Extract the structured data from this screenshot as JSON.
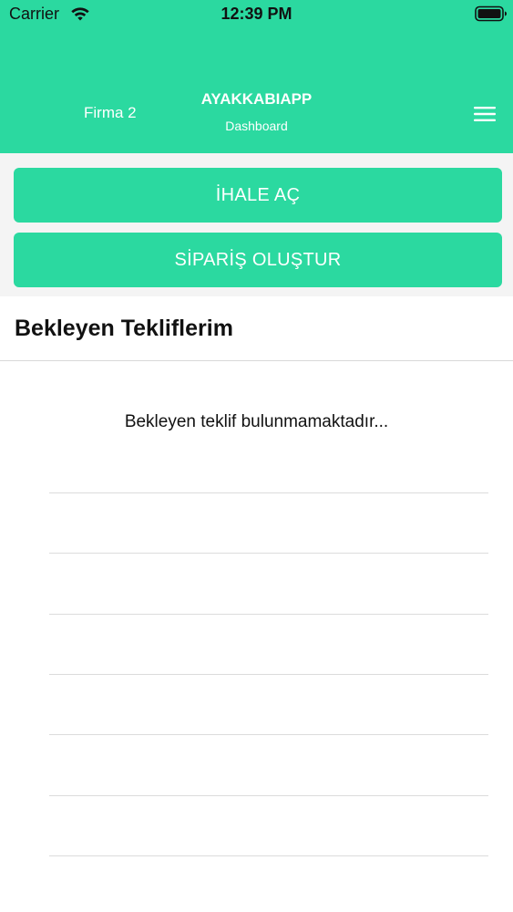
{
  "status_bar": {
    "carrier": "Carrier",
    "time": "12:39 PM"
  },
  "header": {
    "company": "Firma 2",
    "title": "AYAKKABIAPP",
    "subtitle": "Dashboard",
    "background_color": "#2bd9a0"
  },
  "actions": {
    "tender_label": "İHALE AÇ",
    "order_label": "SİPARİŞ OLUŞTUR"
  },
  "pending_offers": {
    "title": "Bekleyen Tekliflerim",
    "empty_message": "Bekleyen teklif bulunmamaktadır..."
  },
  "icons": {
    "wifi": "wifi-icon",
    "battery": "battery-icon",
    "menu": "hamburger-menu-icon"
  },
  "colors": {
    "accent": "#2bd9a0",
    "text": "#111111"
  }
}
